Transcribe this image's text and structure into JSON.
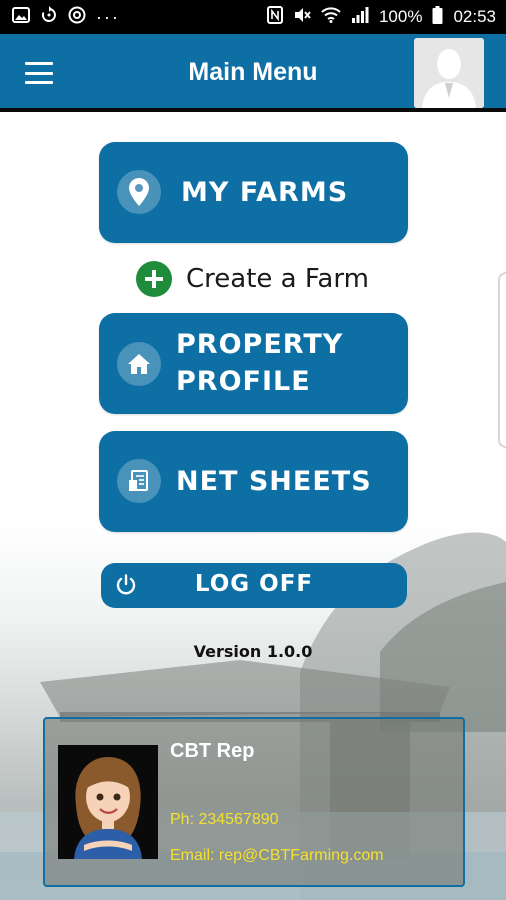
{
  "status_bar": {
    "left_icons": [
      "image-icon",
      "sync-icon",
      "instagram-icon",
      "more-dots-icon"
    ],
    "right_icons": [
      "nfc-icon",
      "mute-icon",
      "wifi-icon",
      "signal-icon",
      "battery-icon"
    ],
    "battery": "100%",
    "time": "02:53"
  },
  "app_bar": {
    "title": "Main Menu"
  },
  "menu": {
    "my_farms": "MY FARMS",
    "create_farm": "Create a Farm",
    "property_profile_line1": "PROPERTY",
    "property_profile_line2": "PROFILE",
    "net_sheets": "NET SHEETS",
    "log_off": "LOG OFF"
  },
  "version": "Version 1.0.0",
  "rep": {
    "name": "CBT Rep",
    "phone": "Ph: 234567890",
    "email": "Email: rep@CBTFarming.com"
  },
  "colors": {
    "primary": "#0d6fa4",
    "status_bar": "#000000",
    "plus_green": "#1e8c3a",
    "contact_yellow": "#f5e030"
  }
}
